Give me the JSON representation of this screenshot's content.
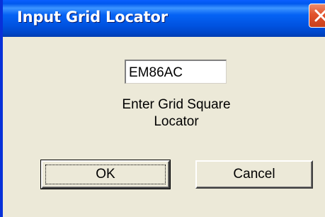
{
  "window": {
    "title": "Input Grid Locator"
  },
  "titlebar": {
    "close_icon": "close-x-icon"
  },
  "grid_input": {
    "value": "EM86AC"
  },
  "prompt": {
    "line1": "Enter Grid Square",
    "line2": "Locator"
  },
  "buttons": {
    "ok_label": "OK",
    "cancel_label": "Cancel"
  },
  "colors": {
    "titlebar_blue": "#0058ee",
    "close_red": "#e2532c",
    "dialog_bg": "#ece9d8"
  }
}
